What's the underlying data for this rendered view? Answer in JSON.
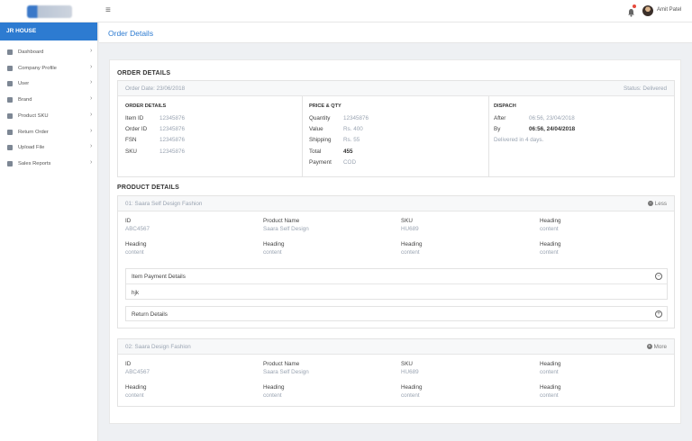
{
  "topbar": {
    "menu_icon": "menu-icon",
    "bell_icon": "bell-icon",
    "user_name": "Amit Patel"
  },
  "sidebar": {
    "header": "JR HOUSE",
    "items": [
      {
        "label": "Dashboard",
        "icon": "dashboard-icon"
      },
      {
        "label": "Company Profile",
        "icon": "building-icon"
      },
      {
        "label": "User",
        "icon": "user-icon"
      },
      {
        "label": "Brand",
        "icon": "rocket-icon"
      },
      {
        "label": "Product SKU",
        "icon": "gear-icon"
      },
      {
        "label": "Return Order",
        "icon": "share-icon"
      },
      {
        "label": "Upload File",
        "icon": "cloud-upload-icon"
      },
      {
        "label": "Sales Reports",
        "icon": "file-icon"
      }
    ]
  },
  "page": {
    "title": "Order Details"
  },
  "order": {
    "section_title": "ORDER DETAILS",
    "order_date": "Order Date: 23/06/2018",
    "status": "Status: Delivered",
    "details": {
      "title": "ORDER DETAILS",
      "rows": [
        [
          "Item ID",
          "12345876"
        ],
        [
          "Order ID",
          "12345876"
        ],
        [
          "FSN",
          "12345876"
        ],
        [
          "SKU",
          "12345876"
        ]
      ]
    },
    "price": {
      "title": "PRICE & QTY",
      "rows": [
        [
          "Quantity",
          "12345876"
        ],
        [
          "Value",
          "Rs. 400"
        ],
        [
          "Shipping",
          "Rs. 55"
        ],
        [
          "Total",
          "455"
        ],
        [
          "Payment",
          "COD"
        ]
      ]
    },
    "dispatch": {
      "title": "DISPACH",
      "after_label": "After",
      "after_value": "06:56, 23/04/2018",
      "by_label": "By",
      "by_value": "06:56, 24/04/2018",
      "note": "Delivered in 4 days."
    }
  },
  "products": {
    "section_title": "PRODUCT DETAILS",
    "items": [
      {
        "title": "01: Saara Self Design Fashion",
        "toggle": "Less",
        "fields": [
          [
            "ID",
            "ABC4567"
          ],
          [
            "Product Name",
            "Saara Self Design"
          ],
          [
            "SKU",
            "HU689"
          ],
          [
            "Heading",
            "content"
          ],
          [
            "Heading",
            "content"
          ],
          [
            "Heading",
            "content"
          ],
          [
            "Heading",
            "content"
          ],
          [
            "Heading",
            "content"
          ]
        ],
        "payment_title": "Item Payment Details",
        "payment_body": "hjk",
        "return_title": "Return Details"
      },
      {
        "title": "02: Saara Design Fashion",
        "toggle": "More",
        "fields": [
          [
            "ID",
            "ABC4567"
          ],
          [
            "Product Name",
            "Saara Self Design"
          ],
          [
            "SKU",
            "HU689"
          ],
          [
            "Heading",
            "content"
          ],
          [
            "Heading",
            "content"
          ],
          [
            "Heading",
            "content"
          ],
          [
            "Heading",
            "content"
          ],
          [
            "Heading",
            "content"
          ]
        ]
      }
    ]
  },
  "colors": {
    "accent": "#2d7bd1",
    "muted": "#9aa4b2",
    "bell_dot": "#e64a3c"
  }
}
